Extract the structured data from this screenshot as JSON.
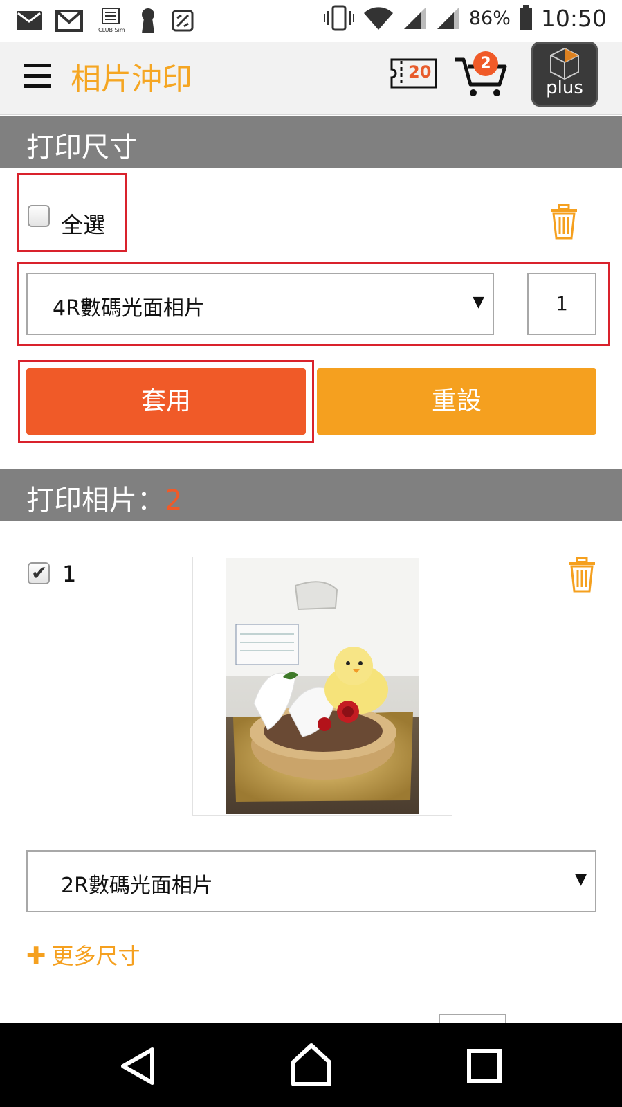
{
  "status_bar": {
    "battery_percent": "86%",
    "time": "10:50",
    "left_icons": [
      "mail-icon",
      "gmail-icon",
      "clubsim-icon",
      "keyhole-icon",
      "no-sim-icon"
    ],
    "right_icons": [
      "vibrate-icon",
      "wifi-icon",
      "signal-icon",
      "signal-icon",
      "battery-icon"
    ]
  },
  "app_bar": {
    "title": "相片沖印",
    "coupon_count": "20",
    "cart_count": "2",
    "plus_label": "plus"
  },
  "size_section": {
    "header": "打印尺寸",
    "select_all_label": "全選",
    "size_select_value": "4R數碼光面相片",
    "quantity_value": "1",
    "apply_label": "套用",
    "reset_label": "重設"
  },
  "photos_section": {
    "header": "打印相片：",
    "count": "2",
    "items": [
      {
        "index": "1",
        "checked": true,
        "size_value": "2R數碼光面相片"
      }
    ],
    "more_sizes_label": "更多尺寸"
  },
  "colors": {
    "accent_orange": "#f5a623",
    "apply_orange": "#f05a28",
    "reset_orange": "#f5a01f",
    "header_gray": "#808080",
    "highlight_red": "#d9222c"
  }
}
